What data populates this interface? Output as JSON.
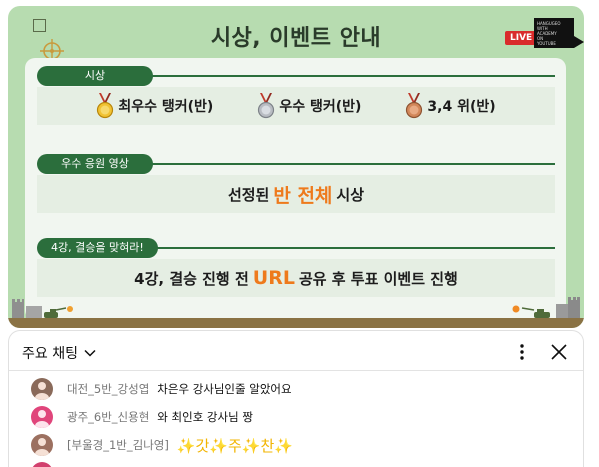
{
  "slide": {
    "title": "시상, 이벤트 안내",
    "live_badge": "LIVE",
    "brand_logo_text": "HANGUGEO\nWITH\nACADEMY\nON\nYOUTUBE"
  },
  "sections": [
    {
      "label": "시상",
      "awards": [
        {
          "medal": "gold",
          "text": "최우수 탱커(반)"
        },
        {
          "medal": "silver",
          "text": "우수 탱커(반)"
        },
        {
          "medal": "bronze",
          "text": "3,4 위(반)"
        }
      ]
    },
    {
      "label": "우수 응원 영상",
      "line_before": "선정된",
      "line_highlight": "반 전체",
      "line_after": "시상"
    },
    {
      "label": "4강, 결승을 맞혀라!",
      "line_before": "4강, 결승 진행 전",
      "line_highlight": "URL",
      "line_after": "공유 후 투표 이벤트 진행"
    }
  ],
  "colors": {
    "slide_bg": "#b7dcb0",
    "section_green": "#2b6e3c",
    "highlight_orange": "#ee7a1c",
    "live_red": "#d92b2b"
  },
  "chat": {
    "mode_label": "주요 채팅",
    "menu_icon": "more-vert-icon",
    "close_icon": "close-icon",
    "messages": [
      {
        "author": "대전_5반_강성엽",
        "text": "차은우 강사님인줄 알았어요",
        "avatar_color": "#8a6a5a"
      },
      {
        "author": "광주_6반_신용현",
        "text": "와 최인호 강사님 짱",
        "avatar_color": "#e0457b"
      },
      {
        "author": "[부울경_1반_김나영]",
        "text": "✨갓✨주✨찬✨",
        "avatar_color": "#9c7060"
      },
      {
        "author": "",
        "text": "",
        "avatar_color": "#d2406e"
      }
    ]
  }
}
